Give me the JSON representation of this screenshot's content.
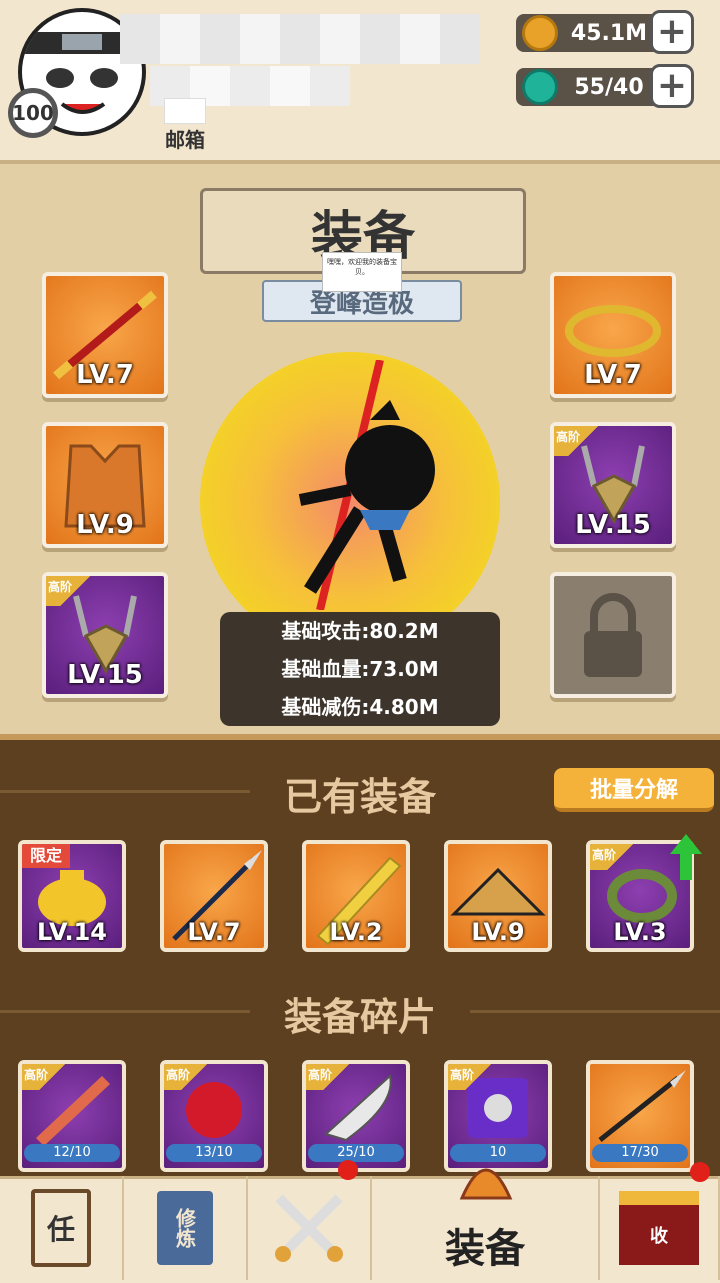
{
  "header": {
    "level": "100",
    "mailbox_label": "邮箱",
    "resources": [
      {
        "icon": "coin-icon",
        "value": "45.1M",
        "color": "#e8a22a"
      },
      {
        "icon": "gem-icon",
        "value": "55/40",
        "color": "#1fb39a"
      }
    ]
  },
  "equipment": {
    "title": "装备",
    "subtitle": "登峰造极",
    "tooltip": "嘿嘿，欢迎我的装备宝贝。",
    "slots": [
      {
        "name": "weapon-staff",
        "level": "LV.7",
        "rarity": "orange",
        "tag": ""
      },
      {
        "name": "armor-vest",
        "level": "LV.9",
        "rarity": "orange",
        "tag": ""
      },
      {
        "name": "necklace-left",
        "level": "LV.15",
        "rarity": "purple",
        "tag": "高阶"
      },
      {
        "name": "headband-ring",
        "level": "LV.7",
        "rarity": "orange",
        "tag": ""
      },
      {
        "name": "necklace-right",
        "level": "LV.15",
        "rarity": "purple",
        "tag": "高阶"
      }
    ],
    "stats": [
      "基础攻击:80.2M",
      "基础血量:73.0M",
      "基础减伤:4.80M"
    ]
  },
  "owned": {
    "title": "已有装备",
    "decompose_label": "批量分解",
    "items": [
      {
        "name": "gold-pouch",
        "level": "LV.14",
        "rarity": "purple",
        "tag": "限定"
      },
      {
        "name": "spear",
        "level": "LV.7",
        "rarity": "orange",
        "tag": ""
      },
      {
        "name": "golden-sword",
        "level": "LV.2",
        "rarity": "orange",
        "tag": ""
      },
      {
        "name": "straw-hat",
        "level": "LV.9",
        "rarity": "orange",
        "tag": ""
      },
      {
        "name": "jade-bracelet",
        "level": "LV.3",
        "rarity": "purple",
        "tag": "高阶"
      }
    ]
  },
  "fragments": {
    "title": "装备碎片",
    "items": [
      {
        "name": "wooden-sword-fragment",
        "progress": "12/10",
        "rarity": "purple",
        "tag": "高阶"
      },
      {
        "name": "spiked-gauntlet-fragment",
        "progress": "13/10",
        "rarity": "purple",
        "tag": "高阶"
      },
      {
        "name": "broadsword-fragment",
        "progress": "25/10",
        "rarity": "purple",
        "tag": "高阶"
      },
      {
        "name": "purple-armor-fragment",
        "progress": "10",
        "rarity": "purple",
        "tag": "高阶"
      },
      {
        "name": "halberd-fragment",
        "progress": "17/30",
        "rarity": "orange",
        "tag": ""
      }
    ]
  },
  "nav": {
    "task_label": "任",
    "cultivate_label": "修炼",
    "equip_label": "装备",
    "shop_label": "收"
  }
}
